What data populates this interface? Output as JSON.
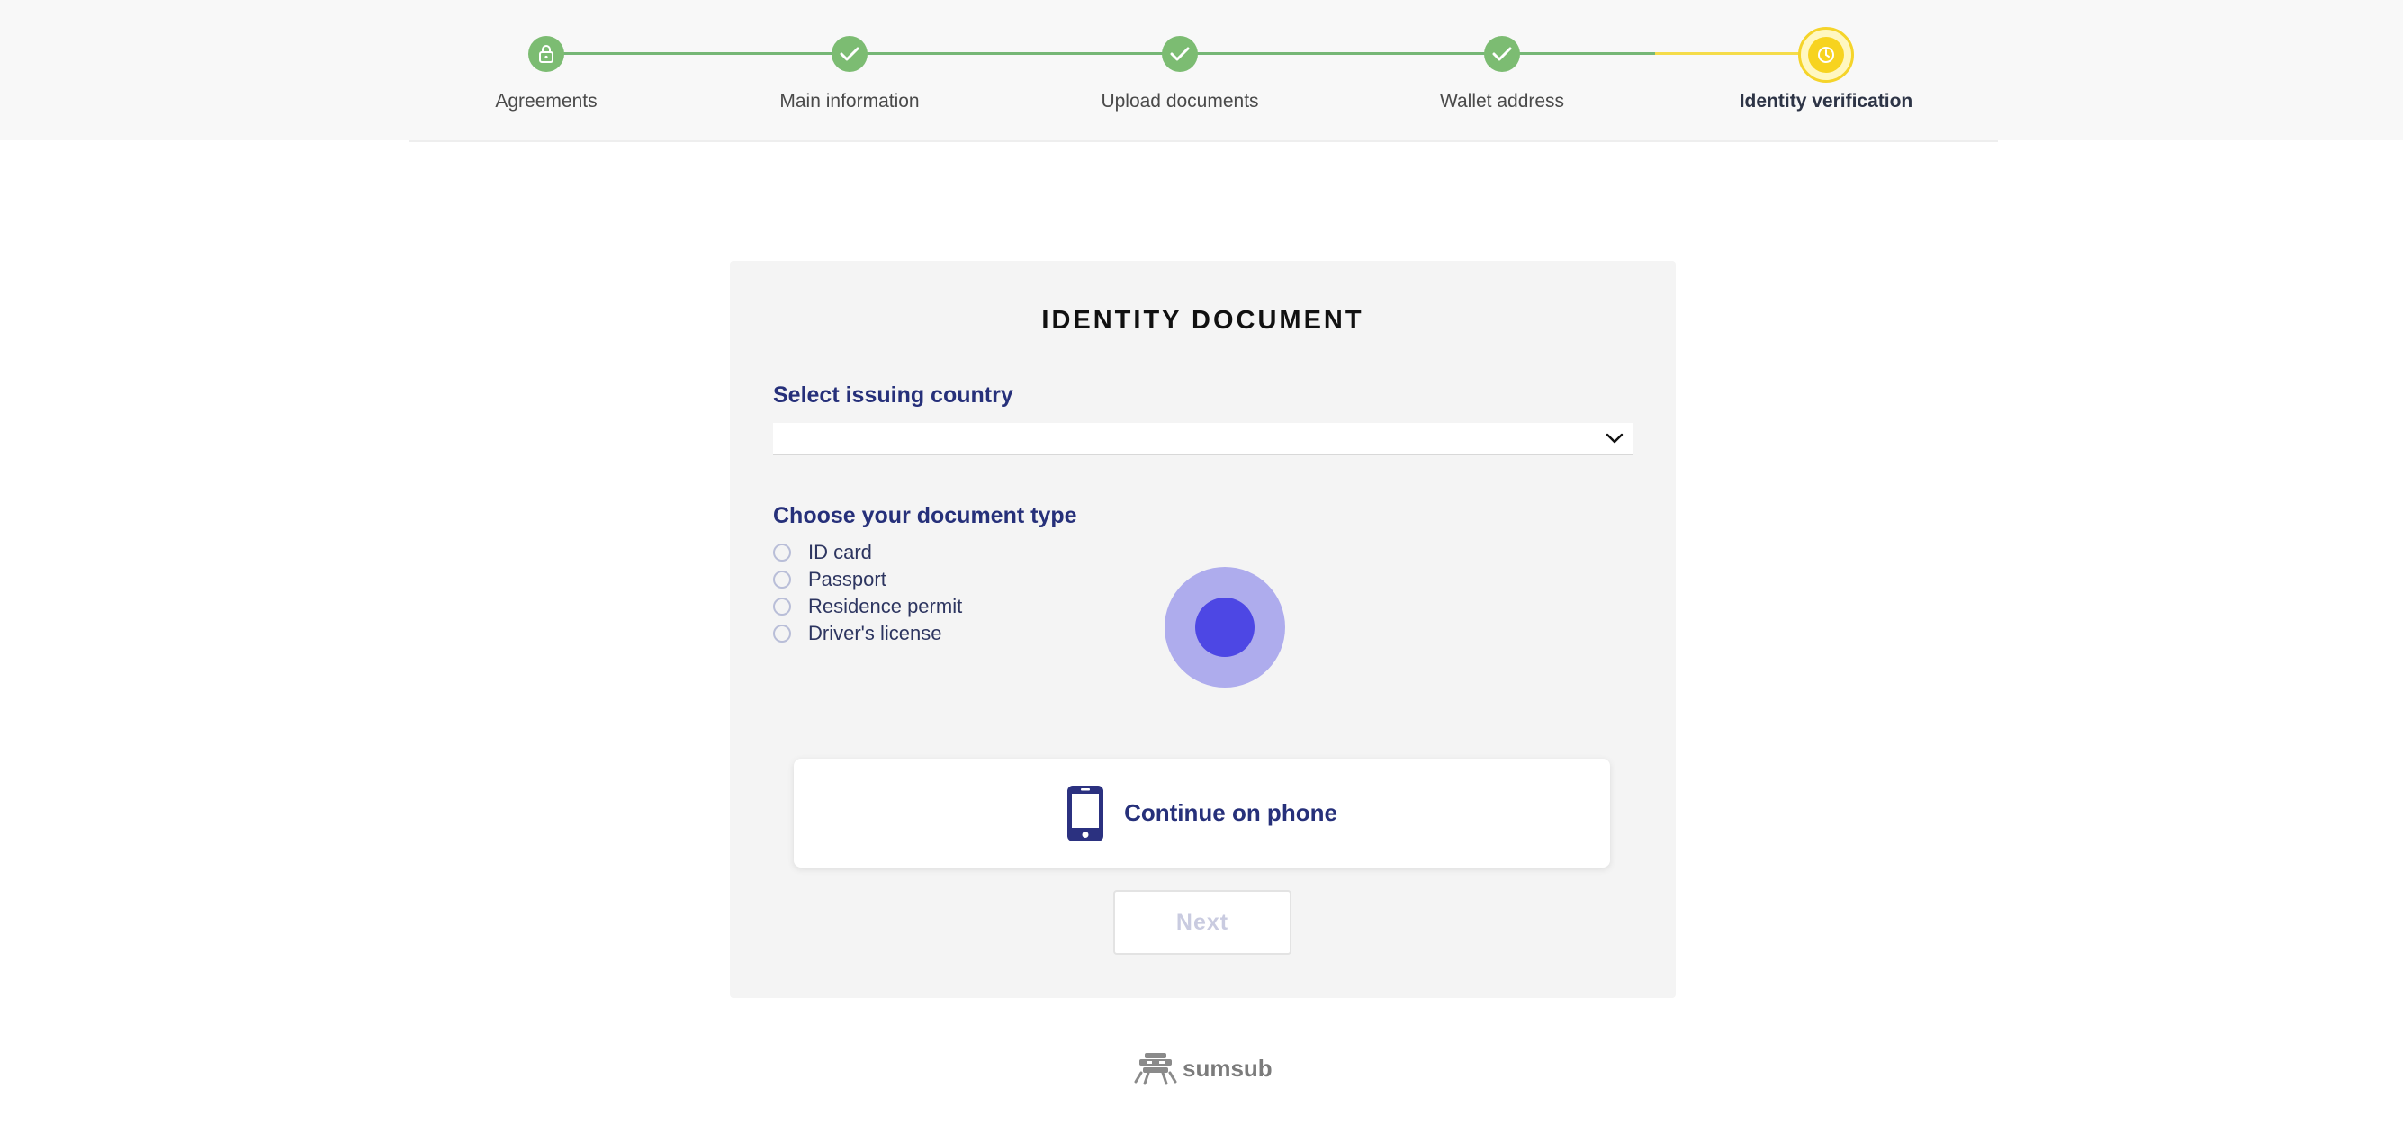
{
  "stepper": {
    "steps": [
      {
        "label": "Agreements",
        "status": "done",
        "icon": "lock-icon"
      },
      {
        "label": "Main information",
        "status": "done",
        "icon": "check-icon"
      },
      {
        "label": "Upload documents",
        "status": "done",
        "icon": "check-icon"
      },
      {
        "label": "Wallet address",
        "status": "done",
        "icon": "check-icon"
      },
      {
        "label": "Identity verification",
        "status": "active",
        "icon": "clock-icon"
      }
    ],
    "colors": {
      "done": "#7cbc72",
      "active": "#f7d31f"
    }
  },
  "card": {
    "title": "IDENTITY DOCUMENT",
    "country": {
      "label": "Select issuing country",
      "value": "",
      "icon": "chevron-down-icon"
    },
    "document_type": {
      "label": "Choose your document type",
      "options": [
        "ID card",
        "Passport",
        "Residence permit",
        "Driver's license"
      ]
    },
    "continue_on_phone": {
      "label": "Continue on phone",
      "icon": "smartphone-icon"
    },
    "next": {
      "label": "Next"
    }
  },
  "footer": {
    "brand": "sumsub",
    "icon": "sumsub-logo-icon"
  }
}
